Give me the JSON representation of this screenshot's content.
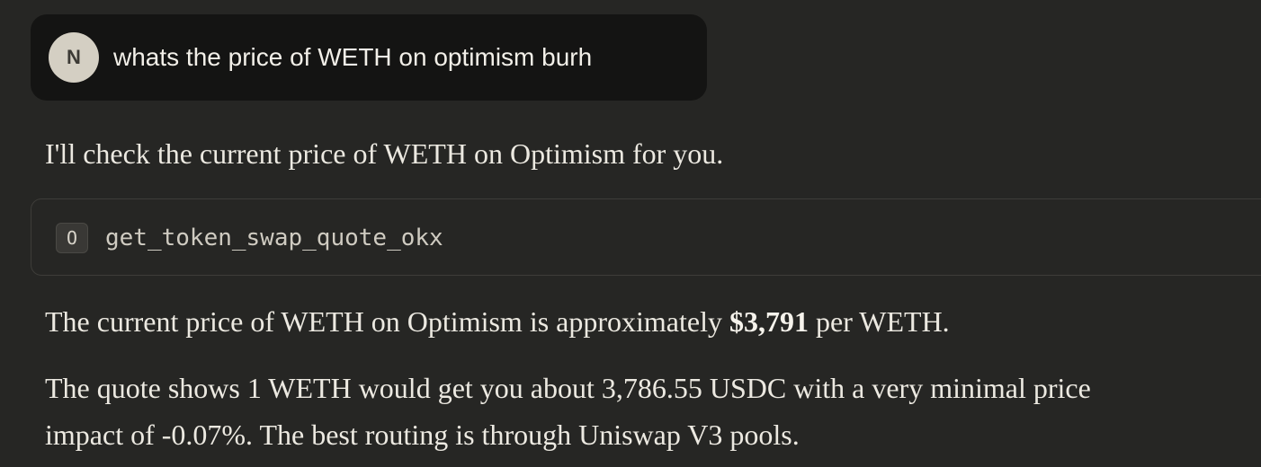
{
  "user_message": {
    "avatar_initial": "N",
    "text": "whats the price of WETH on optimism burh"
  },
  "assistant": {
    "intro": "I'll check the current price of WETH on Optimism for you.",
    "tool_call": {
      "icon_label": "O",
      "name": "get_token_swap_quote_okx"
    },
    "answer": {
      "prefix": "The current price of WETH on Optimism is approximately ",
      "price": "$3,791",
      "suffix": " per WETH."
    },
    "details": {
      "line1": "The quote shows 1 WETH would get you about 3,786.55 USDC with a very minimal price",
      "line2": "impact of -0.07%. The best routing is through Uniswap V3 pools."
    }
  }
}
